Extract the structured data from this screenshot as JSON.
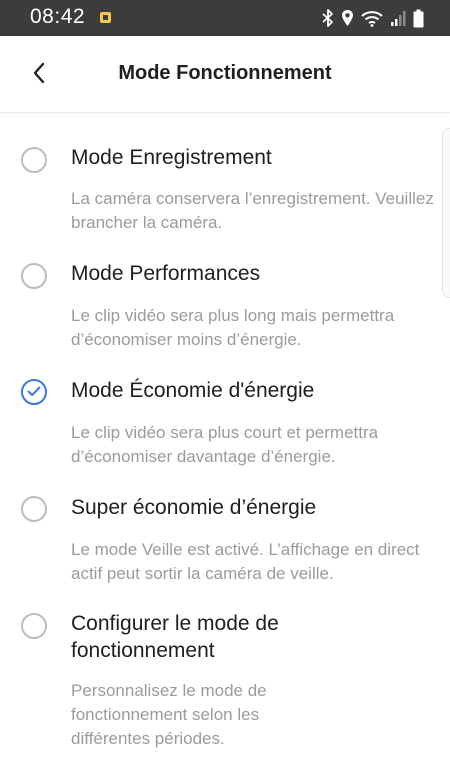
{
  "status_bar": {
    "time": "08:42",
    "icons": [
      "notification-icon",
      "bluetooth-icon",
      "location-icon",
      "wifi-icon",
      "signal-icon",
      "battery-icon"
    ]
  },
  "header": {
    "title": "Mode Fonctionnement",
    "back_icon": "chevron-left-icon"
  },
  "colors": {
    "accent": "#3b78e7",
    "status_bar_bg": "#3c3c3c",
    "description_text": "#9b9b9b"
  },
  "options": [
    {
      "label": "Mode Enregistrement",
      "description": "La caméra conservera l’enregistrement. Veuillez brancher la caméra.",
      "selected": false
    },
    {
      "label": "Mode Performances",
      "description": "Le clip vidéo sera plus long mais permettra d’économiser moins d’énergie.",
      "selected": false
    },
    {
      "label": "Mode Économie d'énergie",
      "description": "Le clip vidéo sera plus court et permettra d’économiser davantage d’énergie.",
      "selected": true
    },
    {
      "label": "Super économie d’énergie",
      "description": "Le mode Veille est activé. L’affichage en direct actif peut sortir la caméra de veille.",
      "selected": false
    },
    {
      "label": "Configurer le mode de fonctionnement",
      "description": "Personnalisez le mode de fonctionnement selon les différentes périodes.",
      "selected": false
    }
  ]
}
